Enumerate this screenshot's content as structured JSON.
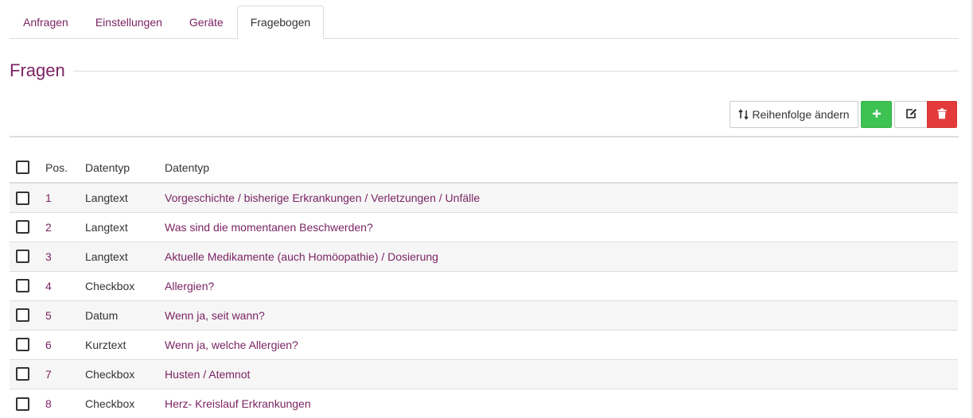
{
  "tabs": [
    {
      "label": "Anfragen",
      "active": false
    },
    {
      "label": "Einstellungen",
      "active": false
    },
    {
      "label": "Geräte",
      "active": false
    },
    {
      "label": "Fragebogen",
      "active": true
    }
  ],
  "section": {
    "title": "Fragen"
  },
  "toolbar": {
    "order_label": "Reihenfolge ändern",
    "order_icon": "sort-icon",
    "add_icon": "plus-icon",
    "edit_icon": "edit-icon",
    "delete_icon": "trash-icon"
  },
  "colors": {
    "accent": "#7b2463",
    "add": "#3ec252",
    "delete": "#e33b3b"
  },
  "table": {
    "headers": [
      "Pos.",
      "Datentyp",
      "Datentyp"
    ],
    "rows": [
      {
        "pos": "1",
        "type": "Langtext",
        "question": "Vorgeschichte / bisherige Erkrankungen / Verletzungen / Unfälle"
      },
      {
        "pos": "2",
        "type": "Langtext",
        "question": "Was sind die momentanen Beschwerden?"
      },
      {
        "pos": "3",
        "type": "Langtext",
        "question": "Aktuelle Medikamente (auch Homöopathie) / Dosierung"
      },
      {
        "pos": "4",
        "type": "Checkbox",
        "question": "Allergien?"
      },
      {
        "pos": "5",
        "type": "Datum",
        "question": "Wenn ja, seit wann?"
      },
      {
        "pos": "6",
        "type": "Kurztext",
        "question": "Wenn ja, welche Allergien?"
      },
      {
        "pos": "7",
        "type": "Checkbox",
        "question": "Husten / Atemnot"
      },
      {
        "pos": "8",
        "type": "Checkbox",
        "question": "Herz- Kreislauf Erkrankungen"
      }
    ]
  }
}
